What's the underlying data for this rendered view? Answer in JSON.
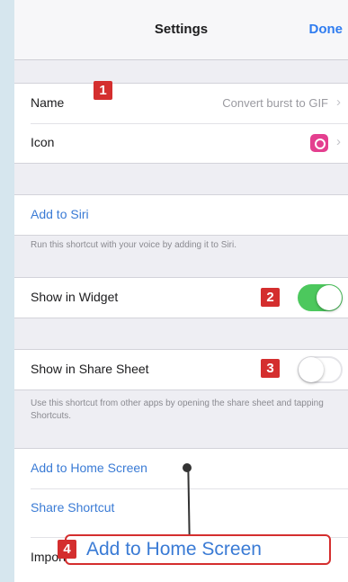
{
  "nav": {
    "title": "Settings",
    "done": "Done"
  },
  "name_row": {
    "label": "Name",
    "value": "Convert burst to GIF"
  },
  "icon_row": {
    "label": "Icon",
    "icon": "shortcut-camera-icon",
    "color": "#e43f8f"
  },
  "siri": {
    "label": "Add to Siri",
    "footer": "Run this shortcut with your voice by adding it to Siri."
  },
  "widget": {
    "label": "Show in Widget",
    "on": true
  },
  "share_sheet": {
    "label": "Show in Share Sheet",
    "on": false,
    "footer": "Use this shortcut from other apps by opening the share sheet and tapping Shortcuts."
  },
  "actions": {
    "home_screen": "Add to Home Screen",
    "share": "Share Shortcut",
    "import": "Import Questions"
  },
  "annotations": {
    "badge1": "1",
    "badge2": "2",
    "badge3": "3",
    "badge4": "4",
    "callout_text": "Add to Home Screen"
  },
  "colors": {
    "accent": "#3a7bd5",
    "toggle_on": "#4cc85d",
    "badge": "#d42e2e"
  }
}
